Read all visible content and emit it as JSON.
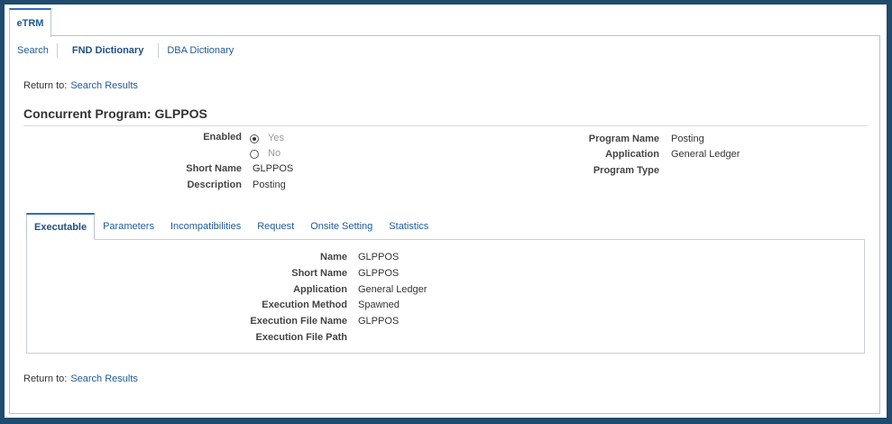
{
  "top_tab": {
    "label": "eTRM"
  },
  "subnav": {
    "items": [
      {
        "label": "Search"
      },
      {
        "label": "FND Dictionary"
      },
      {
        "label": "DBA Dictionary"
      }
    ]
  },
  "return_top": {
    "prefix": "Return to:",
    "link": "Search Results"
  },
  "page_title": "Concurrent Program: GLPPOS",
  "header_fields": {
    "enabled_label": "Enabled",
    "enabled_yes": "Yes",
    "enabled_no": "No",
    "enabled_value": "Yes",
    "short_name_label": "Short Name",
    "short_name_value": "GLPPOS",
    "description_label": "Description",
    "description_value": "Posting",
    "program_name_label": "Program Name",
    "program_name_value": "Posting",
    "application_label": "Application",
    "application_value": "General Ledger",
    "program_type_label": "Program Type",
    "program_type_value": ""
  },
  "tabs": [
    {
      "label": "Executable",
      "active": true
    },
    {
      "label": "Parameters"
    },
    {
      "label": "Incompatibilities"
    },
    {
      "label": "Request"
    },
    {
      "label": "Onsite Setting"
    },
    {
      "label": "Statistics"
    }
  ],
  "executable": {
    "name_label": "Name",
    "name_value": "GLPPOS",
    "short_name_label": "Short Name",
    "short_name_value": "GLPPOS",
    "application_label": "Application",
    "application_value": "General Ledger",
    "execution_method_label": "Execution Method",
    "execution_method_value": "Spawned",
    "execution_file_name_label": "Execution File Name",
    "execution_file_name_value": "GLPPOS",
    "execution_file_path_label": "Execution File Path",
    "execution_file_path_value": ""
  },
  "return_bottom": {
    "prefix": "Return to:",
    "link": "Search Results"
  },
  "colors": {
    "frame": "#1f4b6e",
    "link": "#1f5a96",
    "tab_accent": "#2f6fb0"
  }
}
